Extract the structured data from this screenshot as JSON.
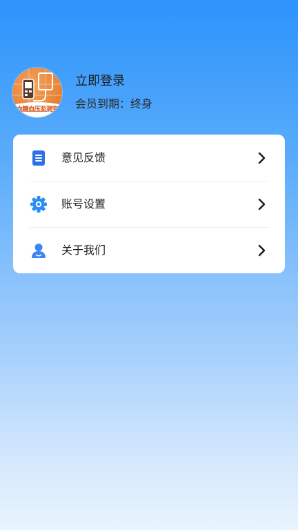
{
  "profile": {
    "login_text": "立即登录",
    "member_expiry": "会员到期：终身",
    "avatar_caption": "血糖血压监测宝"
  },
  "menu": {
    "items": [
      {
        "label": "意见反馈",
        "icon": "feedback-document-icon"
      },
      {
        "label": "账号设置",
        "icon": "gear-icon"
      },
      {
        "label": "关于我们",
        "icon": "user-icon"
      }
    ],
    "chevron_icon": "chevron-right-icon"
  },
  "colors": {
    "gradient_top": "#2c93fb",
    "gradient_bottom": "#e9f4fe",
    "icon_blue": "#2f6fe8",
    "gear_blue": "#2a8df5",
    "user_blue": "#3b86f2",
    "avatar_orange": "#e8853a"
  }
}
